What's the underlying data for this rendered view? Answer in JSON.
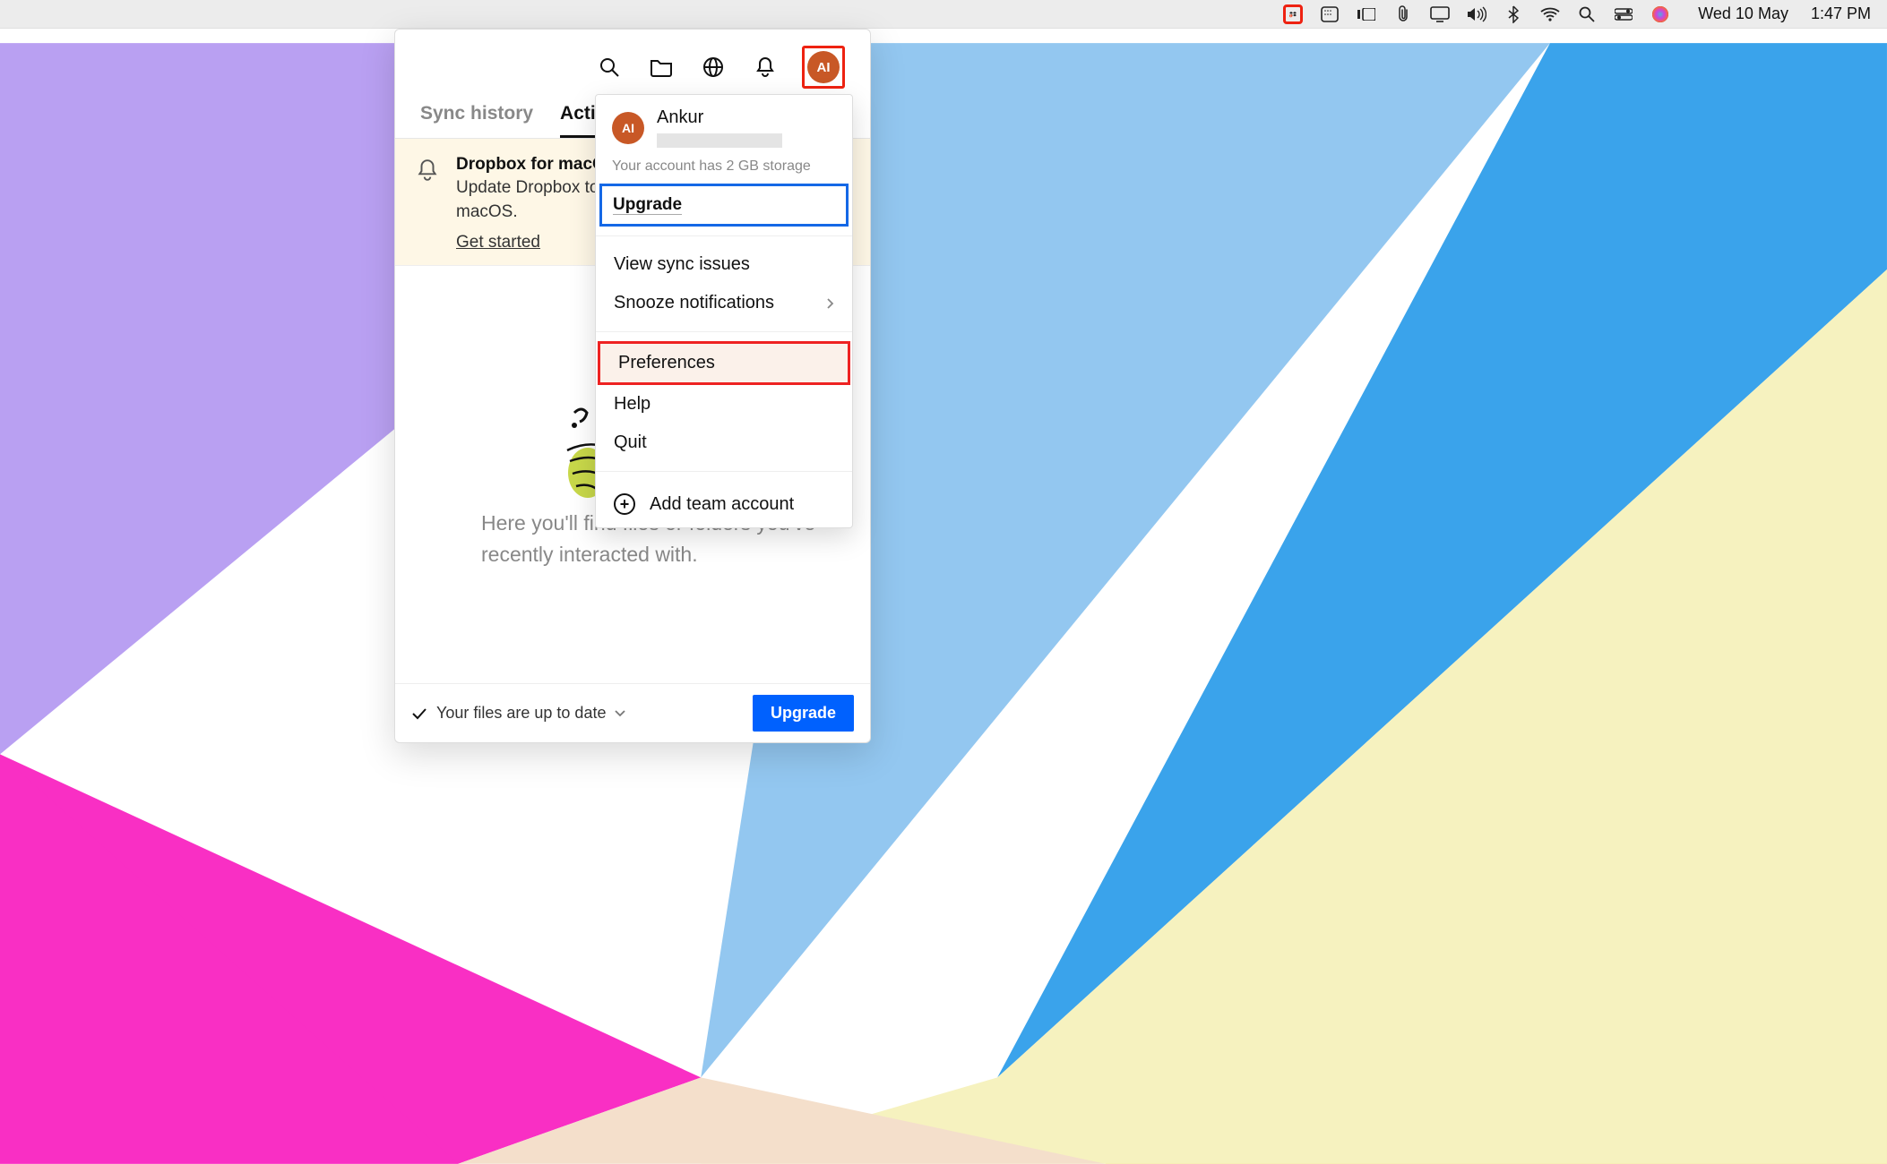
{
  "menubar": {
    "date": "Wed 10 May",
    "time": "1:47 PM"
  },
  "panel": {
    "tabs": {
      "sync": "Sync history",
      "activity": "Activity"
    },
    "notice": {
      "title": "Dropbox for macOS",
      "text": "Update Dropbox to get the latest version for macOS.",
      "link": "Get started"
    },
    "body_msg": "Here you'll find files or folders you've recently interacted with.",
    "status": "Your files are up to date",
    "upgrade_btn": "Upgrade"
  },
  "menu": {
    "user_initials": "AI",
    "user_name": "Ankur",
    "storage": "Your account has 2 GB storage",
    "upgrade": "Upgrade",
    "items": {
      "view_sync": "View sync issues",
      "snooze": "Snooze notifications",
      "preferences": "Preferences",
      "help": "Help",
      "quit": "Quit",
      "add_team": "Add team account"
    }
  },
  "avatar_initials": "AI"
}
